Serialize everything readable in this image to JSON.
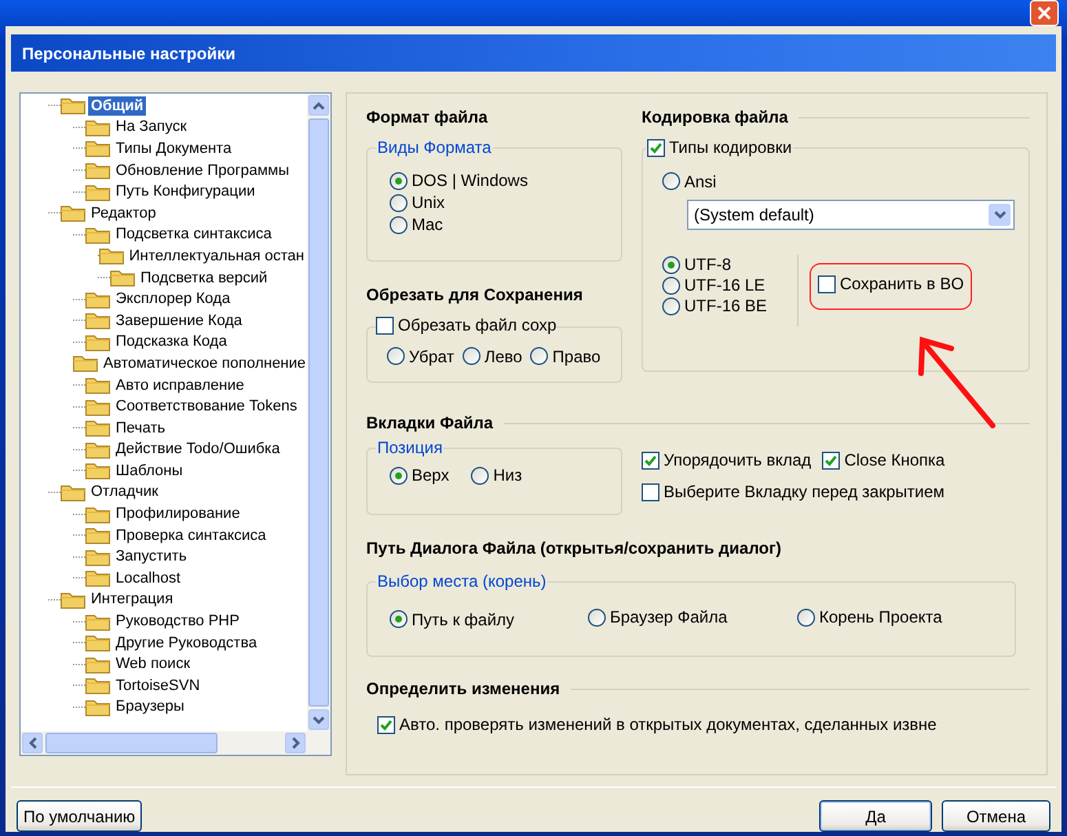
{
  "window": {
    "title": "Персональные настройки"
  },
  "tree": {
    "items": [
      {
        "label": "Общий",
        "selected": true,
        "children": [
          {
            "label": "На Запуск",
            "selected": false
          },
          {
            "label": "Типы Документа",
            "selected": false
          },
          {
            "label": "Обновление Программы",
            "selected": false
          },
          {
            "label": "Путь Конфигурации",
            "selected": false
          }
        ]
      },
      {
        "label": "Редактор",
        "selected": false,
        "children": [
          {
            "label": "Подсветка синтаксиса",
            "selected": false,
            "children": [
              {
                "label": "Интеллектуальная остан",
                "selected": false
              },
              {
                "label": "Подсветка версий",
                "selected": false
              }
            ]
          },
          {
            "label": "Эксплорер Кода",
            "selected": false
          },
          {
            "label": "Завершение Кода",
            "selected": false
          },
          {
            "label": "Подсказка Кода",
            "selected": false
          },
          {
            "label": "Автоматическое пополнение",
            "selected": false
          },
          {
            "label": "Авто исправление",
            "selected": false
          },
          {
            "label": "Соответствование Tokens",
            "selected": false
          },
          {
            "label": "Печать",
            "selected": false
          },
          {
            "label": "Действие Todo/Ошибка",
            "selected": false
          },
          {
            "label": "Шаблоны",
            "selected": false
          }
        ]
      },
      {
        "label": "Отладчик",
        "selected": false,
        "children": [
          {
            "label": "Профилирование",
            "selected": false
          },
          {
            "label": "Проверка синтаксиса",
            "selected": false
          },
          {
            "label": "Запустить",
            "selected": false
          },
          {
            "label": "Localhost",
            "selected": false
          }
        ]
      },
      {
        "label": "Интеграция",
        "selected": false,
        "children": [
          {
            "label": "Руководство PHP",
            "selected": false
          },
          {
            "label": "Другие Руководства",
            "selected": false
          },
          {
            "label": "Web поиск",
            "selected": false
          },
          {
            "label": "TortoiseSVN",
            "selected": false
          },
          {
            "label": "Браузеры",
            "selected": false
          }
        ]
      }
    ]
  },
  "settings": {
    "file_format": {
      "heading": "Формат файла",
      "group_label": "Виды Формата",
      "options": [
        {
          "label": "DOS | Windows",
          "selected": true
        },
        {
          "label": "Unix",
          "selected": false
        },
        {
          "label": "Mac",
          "selected": false
        }
      ]
    },
    "trim": {
      "heading": "Обрезать для Сохранения",
      "checkbox": {
        "label": "Обрезать файл сохр",
        "checked": false
      },
      "options": [
        {
          "label": "Убрат",
          "selected": false
        },
        {
          "label": "Лево",
          "selected": false
        },
        {
          "label": "Право",
          "selected": false
        }
      ]
    },
    "encoding": {
      "heading": "Кодировка файла",
      "checkbox": {
        "label": "Типы кодировки",
        "checked": true
      },
      "ansi": {
        "label": "Ansi",
        "selected": false
      },
      "dropdown": {
        "value": "(System default)"
      },
      "unicode_options": [
        {
          "label": "UTF-8",
          "selected": true
        },
        {
          "label": "UTF-16 LE",
          "selected": false
        },
        {
          "label": "UTF-16 BE",
          "selected": false
        }
      ],
      "bom": {
        "label": "Сохранить в BO",
        "checked": false
      }
    },
    "tabs": {
      "heading": "Вкладки Файла",
      "group_label": "Позиция",
      "options": [
        {
          "label": "Верх",
          "selected": true
        },
        {
          "label": "Низ",
          "selected": false
        }
      ],
      "checkboxes": [
        {
          "label": "Упорядочить вклад",
          "checked": true
        },
        {
          "label": "Close Кнопка",
          "checked": true
        },
        {
          "label": "Выберите Вкладку перед закрытием",
          "checked": false
        }
      ]
    },
    "dialog_path": {
      "heading": "Путь Диалога Файла (открытья/сохранить диалог)",
      "group_label": "Выбор места (корень)",
      "options": [
        {
          "label": "Путь к файлу",
          "selected": true
        },
        {
          "label": "Браузер Файла",
          "selected": false
        },
        {
          "label": "Корень Проекта",
          "selected": false
        }
      ]
    },
    "changes": {
      "heading": "Определить изменения",
      "checkbox": {
        "label": "Авто. проверять изменений в открытых документах, сделанных извне",
        "checked": true
      }
    }
  },
  "buttons": {
    "defaults": "По умолчанию",
    "ok": "Да",
    "cancel": "Отмена"
  }
}
